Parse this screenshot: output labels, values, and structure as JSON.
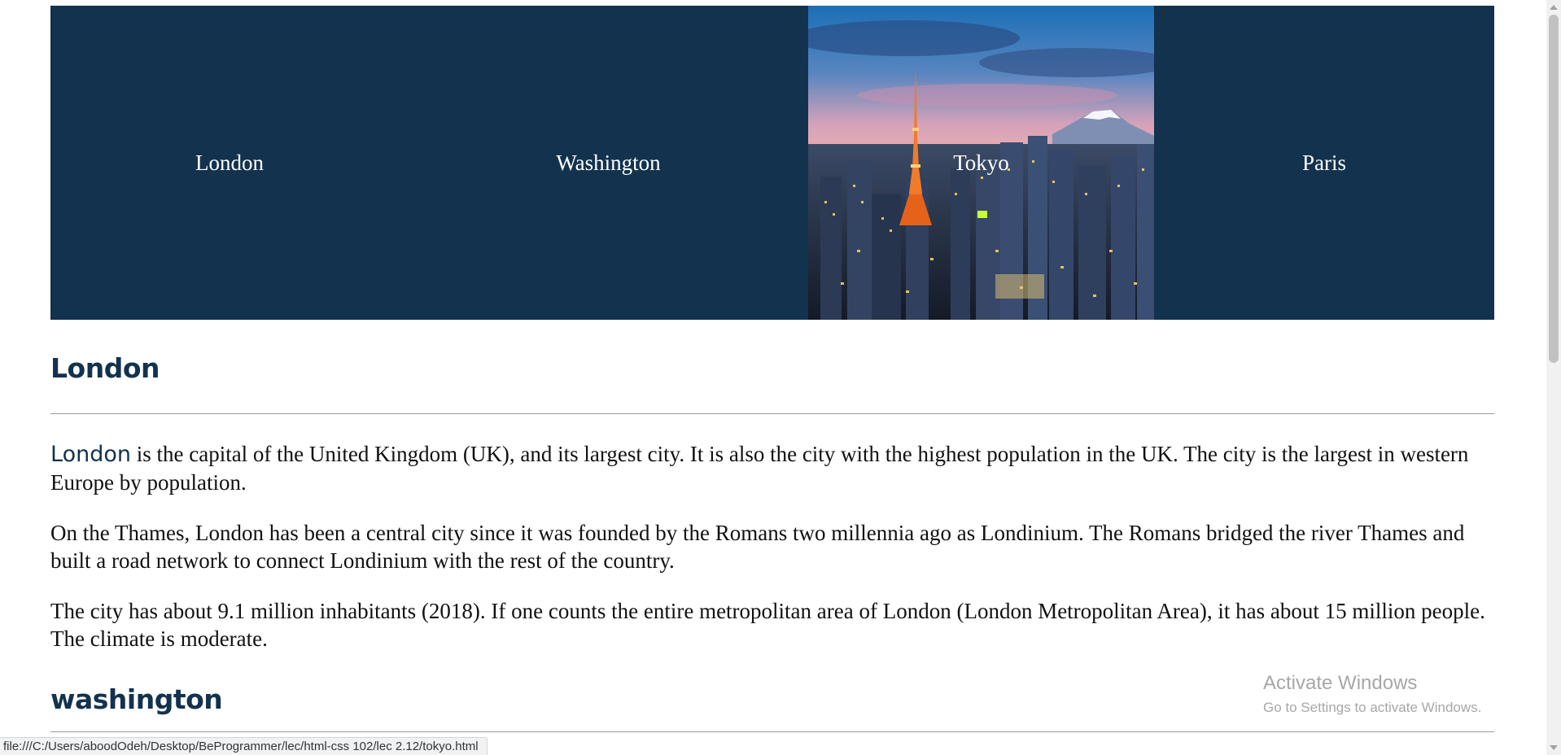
{
  "nav": {
    "items": [
      {
        "label": "London"
      },
      {
        "label": "Washington"
      },
      {
        "label": "Tokyo"
      },
      {
        "label": "Paris"
      }
    ],
    "active_index": 2
  },
  "sections": [
    {
      "title": "London",
      "paragraphs": [
        {
          "lead": "London",
          "text": " is the capital of the United Kingdom (UK), and its largest city. It is also the city with the highest population in the UK. The city is the largest in western Europe by population."
        },
        {
          "text": "On the Thames, London has been a central city since it was founded by the Romans two millennia ago as Londinium. The Romans bridged the river Thames and built a road network to connect Londinium with the rest of the country."
        },
        {
          "text": "The city has about 9.1 million inhabitants (2018). If one counts the entire metropolitan area of London (London Metropolitan Area), it has about 15 million people. The climate is moderate."
        }
      ]
    },
    {
      "title": "washington"
    }
  ],
  "watermark": {
    "title": "Activate Windows",
    "subtitle": "Go to Settings to activate Windows."
  },
  "status_url": "file:///C:/Users/aboodOdeh/Desktop/BeProgrammer/lec/html-css 102/lec 2.12/tokyo.html",
  "colors": {
    "nav_bg": "#13324e",
    "heading": "#13324e",
    "nav_text": "#ffffff"
  },
  "icons": [
    "tokyo-skyline-image"
  ]
}
